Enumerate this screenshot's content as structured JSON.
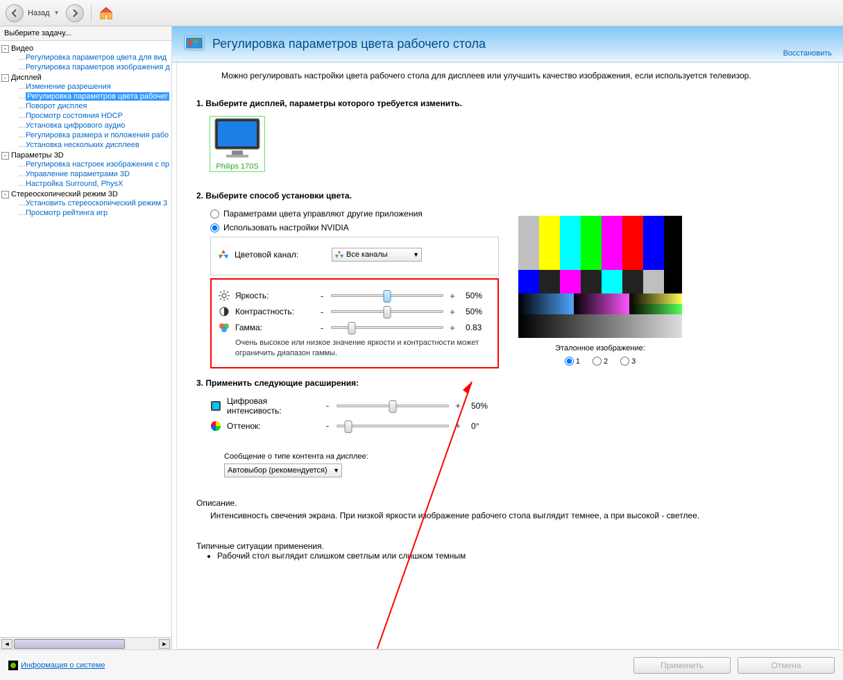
{
  "toolbar": {
    "back_label": "Назад"
  },
  "sidebar": {
    "title": "Выберите задачу...",
    "cats": [
      {
        "label": "Видео",
        "items": [
          "Регулировка параметров цвета для вид",
          "Регулировка параметров изображения д"
        ]
      },
      {
        "label": "Дисплей",
        "items": [
          "Изменение разрешения",
          "Регулировка параметров цвета рабочег",
          "Поворот дисплея",
          "Просмотр состояния HDCP",
          "Установка цифрового аудио",
          "Регулировка размера и положения рабо",
          "Установка нескольких дисплеев"
        ],
        "sel": 1
      },
      {
        "label": "Параметры 3D",
        "items": [
          "Регулировка настроек изображения с пр",
          "Управление параметрами 3D",
          "Настройка Surround, PhysX"
        ]
      },
      {
        "label": "Стереоскопический режим 3D",
        "items": [
          "Установить стереоскопический режим 3",
          "Просмотр рейтинга игр"
        ]
      }
    ]
  },
  "page": {
    "title": "Регулировка параметров цвета рабочего стола",
    "restore": "Восстановить",
    "intro": "Можно регулировать настройки цвета рабочего стола для дисплеев или улучшить качество изображения, если используется телевизор."
  },
  "section1": {
    "title": "1. Выберите дисплей, параметры которого требуется изменить.",
    "monitor": "Philips 170S"
  },
  "section2": {
    "title": "2. Выберите способ установки цвета.",
    "radio_other": "Параметрами цвета управляют другие приложения",
    "radio_nvidia": "Использовать настройки NVIDIA",
    "channel_label": "Цветовой канал:",
    "channel_value": "Все каналы",
    "brightness": {
      "label": "Яркость:",
      "value": "50%",
      "pos": 50
    },
    "contrast": {
      "label": "Контрастность:",
      "value": "50%",
      "pos": 50
    },
    "gamma": {
      "label": "Гамма:",
      "value": "0.83",
      "pos": 18
    },
    "note": "Очень высокое или низкое значение яркости и контрастности может ограничить диапазон гаммы."
  },
  "ref": {
    "label": "Эталонное изображение:",
    "r1": "1",
    "r2": "2",
    "r3": "3"
  },
  "section3": {
    "title": "3. Применить следующие расширения:",
    "digital": {
      "label": "Цифровая интенсивость:",
      "value": "50%",
      "pos": 50
    },
    "hue": {
      "label": "Оттенок:",
      "value": "0°",
      "pos": 10
    },
    "content_type_label": "Сообщение о типе контента на дисплее:",
    "content_type_value": "Автовыбор (рекомендуется)"
  },
  "description": {
    "h": "Описание.",
    "body": "Интенсивность свечения экрана. При низкой яркости изображение рабочего стола выглядит темнее, а при высокой - светлее."
  },
  "typical": {
    "h": "Типичные ситуации применения.",
    "item1": "Рабочий стол выглядит слишком светлым или слишком темным"
  },
  "footer": {
    "sysinfo": "Информация о системе",
    "apply": "Применить",
    "cancel": "Отмена"
  }
}
